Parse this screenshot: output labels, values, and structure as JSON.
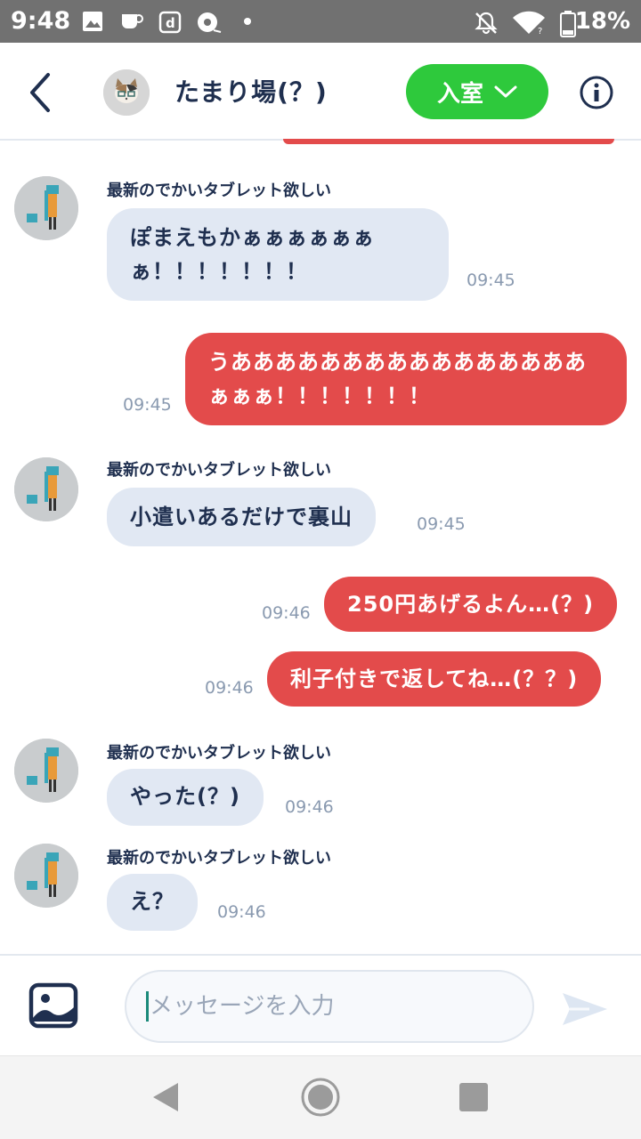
{
  "status_bar": {
    "time": "9:48",
    "battery": "18%"
  },
  "header": {
    "room_name": "たまり場(？)",
    "enter_label": "入室"
  },
  "messages": [
    {
      "sender": "最新のでかいタブレット欲しい",
      "text": "ぽまえもかぁぁぁぁぁぁぁ！！！！！！！",
      "time": "09:45"
    },
    {
      "text": "うああああああああああああああああぁぁぁ！！！！！！！",
      "time": "09:45"
    },
    {
      "sender": "最新のでかいタブレット欲しい",
      "text": "小遣いあるだけで裏山",
      "time": "09:45"
    },
    {
      "text": "250円あげるよん…(？)",
      "time": "09:46"
    },
    {
      "text": "利子付きで返してね…(？？)",
      "time": "09:46"
    },
    {
      "sender": "最新のでかいタブレット欲しい",
      "text": "やった(？)",
      "time": "09:46"
    },
    {
      "sender": "最新のでかいタブレット欲しい",
      "text": "え？",
      "time": "09:46"
    }
  ],
  "input": {
    "placeholder": "メッセージを入力"
  },
  "icons": {
    "back": "chevron-left-icon",
    "info": "info-icon",
    "image": "image-icon",
    "send": "send-icon"
  },
  "colors": {
    "accent_green": "#2ec93c",
    "outgoing_bubble": "#e34b4b",
    "incoming_bubble": "#e1e8f3",
    "text_dark": "#1f2f4f"
  }
}
